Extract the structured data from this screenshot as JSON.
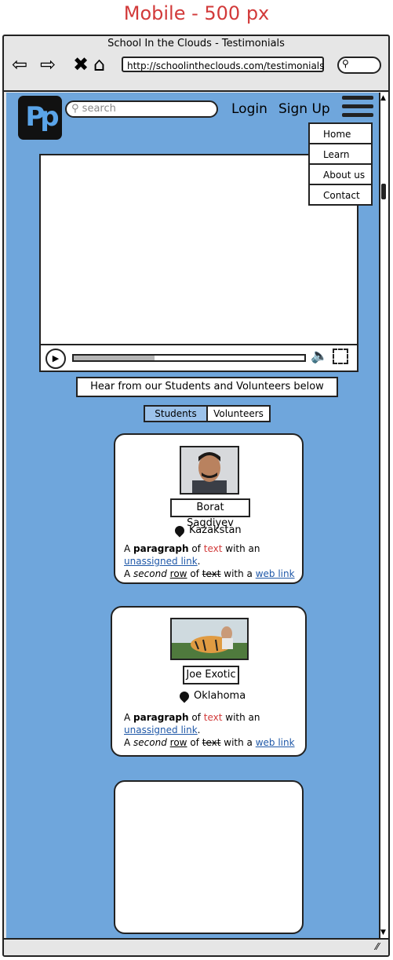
{
  "heading": "Mobile - 500 px",
  "window": {
    "title": "School In the Clouds - Testimonials",
    "url": "http://schoolintheclouds.com/testimonials"
  },
  "nav": {
    "logo": "Pp",
    "search_placeholder": "search",
    "login": "Login",
    "signup": "Sign Up",
    "menu": [
      "Home",
      "Learn",
      "About us",
      "Contact"
    ]
  },
  "video": {
    "progress": 0.35
  },
  "banner": "Hear from our Students and Volunteers below",
  "tabs": {
    "active": "Students",
    "inactive": "Volunteers"
  },
  "cards": [
    {
      "name": "Borat Sagdiyev",
      "location": "Kazakstan",
      "p1": "A",
      "p2": "paragraph",
      "p3": "of",
      "p4": "text",
      "p5": "with an",
      "l1": "unassigned link",
      "l1p": ".",
      "r1": "A",
      "r2": "second",
      "r3": "row",
      "r4": "of",
      "r5": "text",
      "r6": "with a",
      "r7": "web link"
    },
    {
      "name": "Joe Exotic",
      "location": "Oklahoma",
      "p1": "A",
      "p2": "paragraph",
      "p3": "of",
      "p4": "text",
      "p5": "with an",
      "l1": "unassigned link",
      "l1p": ".",
      "r1": "A",
      "r2": "second",
      "r3": "row",
      "r4": "of",
      "r5": "text",
      "r6": "with a",
      "r7": "web link"
    }
  ]
}
